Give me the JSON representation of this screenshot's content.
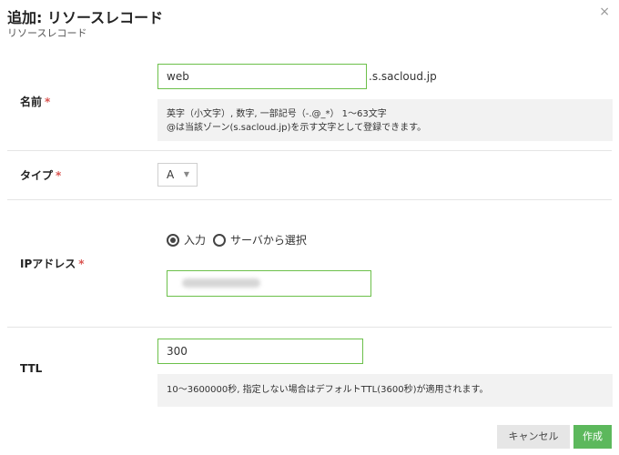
{
  "header": {
    "title": "追加: リソースレコード",
    "subtitle": "リソースレコード",
    "close_icon": "×"
  },
  "form": {
    "name": {
      "label": "名前",
      "required_mark": "*",
      "value": "web",
      "suffix": ".s.sacloud.jp",
      "help_line1": "英字（小文字）, 数字, 一部記号（-.@_*） 1～63文字",
      "help_line2": "@は当該ゾーン(s.sacloud.jp)を示す文字として登録できます。"
    },
    "type": {
      "label": "タイプ",
      "required_mark": "*",
      "selected": "A",
      "arrow_icon": "▼"
    },
    "ip": {
      "label": "IPアドレス",
      "required_mark": "*",
      "options": [
        {
          "label": "入力",
          "checked": true
        },
        {
          "label": "サーバから選択",
          "checked": false
        }
      ]
    },
    "ttl": {
      "label": "TTL",
      "value": "300",
      "help": "10～3600000秒, 指定しない場合はデフォルトTTL(3600秒)が適用されます。"
    }
  },
  "buttons": {
    "cancel": "キャンセル",
    "create": "作成"
  },
  "colors": {
    "accent_green": "#5cb85c",
    "input_border_green": "#6cc04a",
    "required_red": "#d9534f"
  }
}
